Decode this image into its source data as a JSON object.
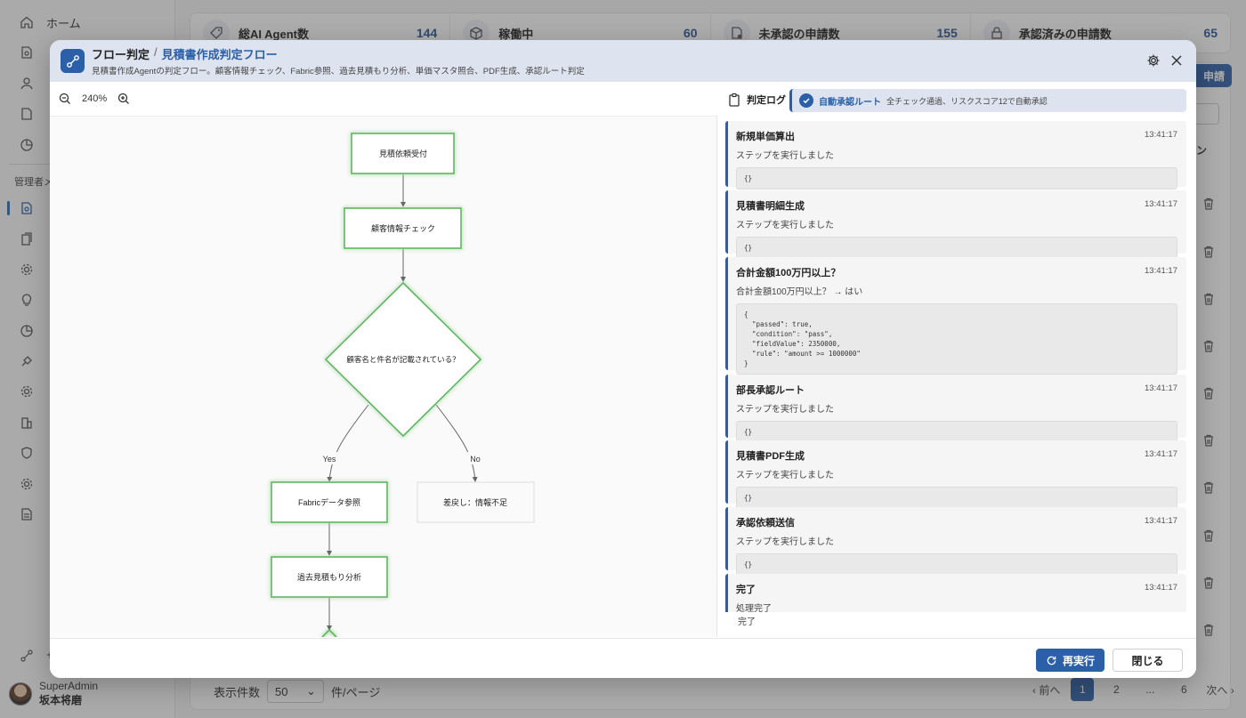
{
  "sidebar": {
    "items": [
      {
        "label": "ホーム",
        "icon": "home-icon"
      },
      {
        "label": "",
        "icon": "user-doc-icon"
      },
      {
        "label": "",
        "icon": "person-icon"
      },
      {
        "label": "",
        "icon": "document-icon"
      },
      {
        "label": "",
        "icon": "chart-icon"
      }
    ],
    "section_label": "管理者メ",
    "admin_items": [
      {
        "icon": "agent-doc-icon"
      },
      {
        "icon": "docs-icon"
      },
      {
        "icon": "gear-icon"
      },
      {
        "icon": "bulb-icon"
      },
      {
        "icon": "pie-icon"
      },
      {
        "icon": "plug-icon"
      },
      {
        "icon": "gear-icon"
      },
      {
        "icon": "building-icon"
      },
      {
        "icon": "shield-icon"
      },
      {
        "icon": "gear-icon"
      },
      {
        "icon": "list-icon"
      }
    ],
    "bottom_item": {
      "label": "サ",
      "icon": "flow-icon"
    },
    "user": {
      "role": "SuperAdmin",
      "name": "坂本将磨"
    }
  },
  "stats": [
    {
      "label": "総AI Agent数",
      "value": "144",
      "icon": "tag-icon"
    },
    {
      "label": "稼働中",
      "value": "60",
      "icon": "box-icon"
    },
    {
      "label": "未承認の申請数",
      "value": "155",
      "icon": "pending-doc-icon"
    },
    {
      "label": "承認済みの申請数",
      "value": "65",
      "icon": "lock-icon"
    }
  ],
  "background": {
    "apply_button": "申請",
    "column_header": "ン",
    "pager": {
      "per_page_label": "表示件数",
      "per_page_value": "50",
      "per_page_suffix": "件/ページ",
      "prev": "前へ",
      "pages": [
        "1",
        "2",
        "...",
        "6"
      ],
      "next": "次へ"
    }
  },
  "modal": {
    "title_prefix": "フロー判定",
    "title_sep": "/",
    "title": "見積書作成判定フロー",
    "subtitle": "見積書作成Agentの判定フロー。顧客情報チェック、Fabric参照、過去見積もり分析、単価マスタ照合、PDF生成、承認ルート判定",
    "zoom": "240%",
    "flow": {
      "nodes": {
        "n1": "見積依頼受付",
        "n2": "顧客情報チェック",
        "d1": "顧客名と件名が記載されている？",
        "n3": "Fabricデータ参照",
        "n4": "差戻し：情報不足",
        "n5": "過去見積もり分析"
      },
      "edge_yes": "Yes",
      "edge_no": "No"
    },
    "log": {
      "title": "判定ログ",
      "result_label": "自動承認ルート",
      "result_detail": "全チェック通過、リスクスコア12で自動承認",
      "entries": [
        {
          "title": "新規単価算出",
          "time": "13:41:17",
          "message": "ステップを実行しました",
          "code": "{}"
        },
        {
          "title": "見積書明細生成",
          "time": "13:41:17",
          "message": "ステップを実行しました",
          "code": "{}"
        },
        {
          "title": "合計金額100万円以上？",
          "time": "13:41:17",
          "message": "合計金額100万円以上？ → はい",
          "code": "{\n  \"passed\": true,\n  \"condition\": \"pass\",\n  \"fieldValue\": 2350000,\n  \"rule\": \"amount >= 1000000\"\n}"
        },
        {
          "title": "部長承認ルート",
          "time": "13:41:17",
          "message": "ステップを実行しました",
          "code": "{}"
        },
        {
          "title": "見積書PDF生成",
          "time": "13:41:17",
          "message": "ステップを実行しました",
          "code": "{}"
        },
        {
          "title": "承認依頼送信",
          "time": "13:41:17",
          "message": "ステップを実行しました",
          "code": "{}"
        },
        {
          "title": "完了",
          "time": "13:41:17",
          "message": "処理完了",
          "code": ""
        }
      ],
      "tail_text": "完了"
    },
    "buttons": {
      "rerun": "再実行",
      "close": "閉じる"
    }
  }
}
